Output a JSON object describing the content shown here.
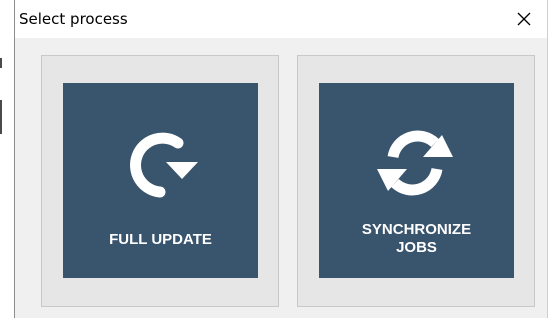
{
  "dialog": {
    "title": "Select process"
  },
  "buttons": [
    {
      "label": "FULL UPDATE",
      "icon": "redo-arrow-icon"
    },
    {
      "label": "SYNCHRONIZE\nJOBS",
      "icon": "sync-arrows-icon"
    }
  ],
  "colors": {
    "tile": "#39546d",
    "panel": "#e6e6e6",
    "window": "#f0f0f0"
  }
}
